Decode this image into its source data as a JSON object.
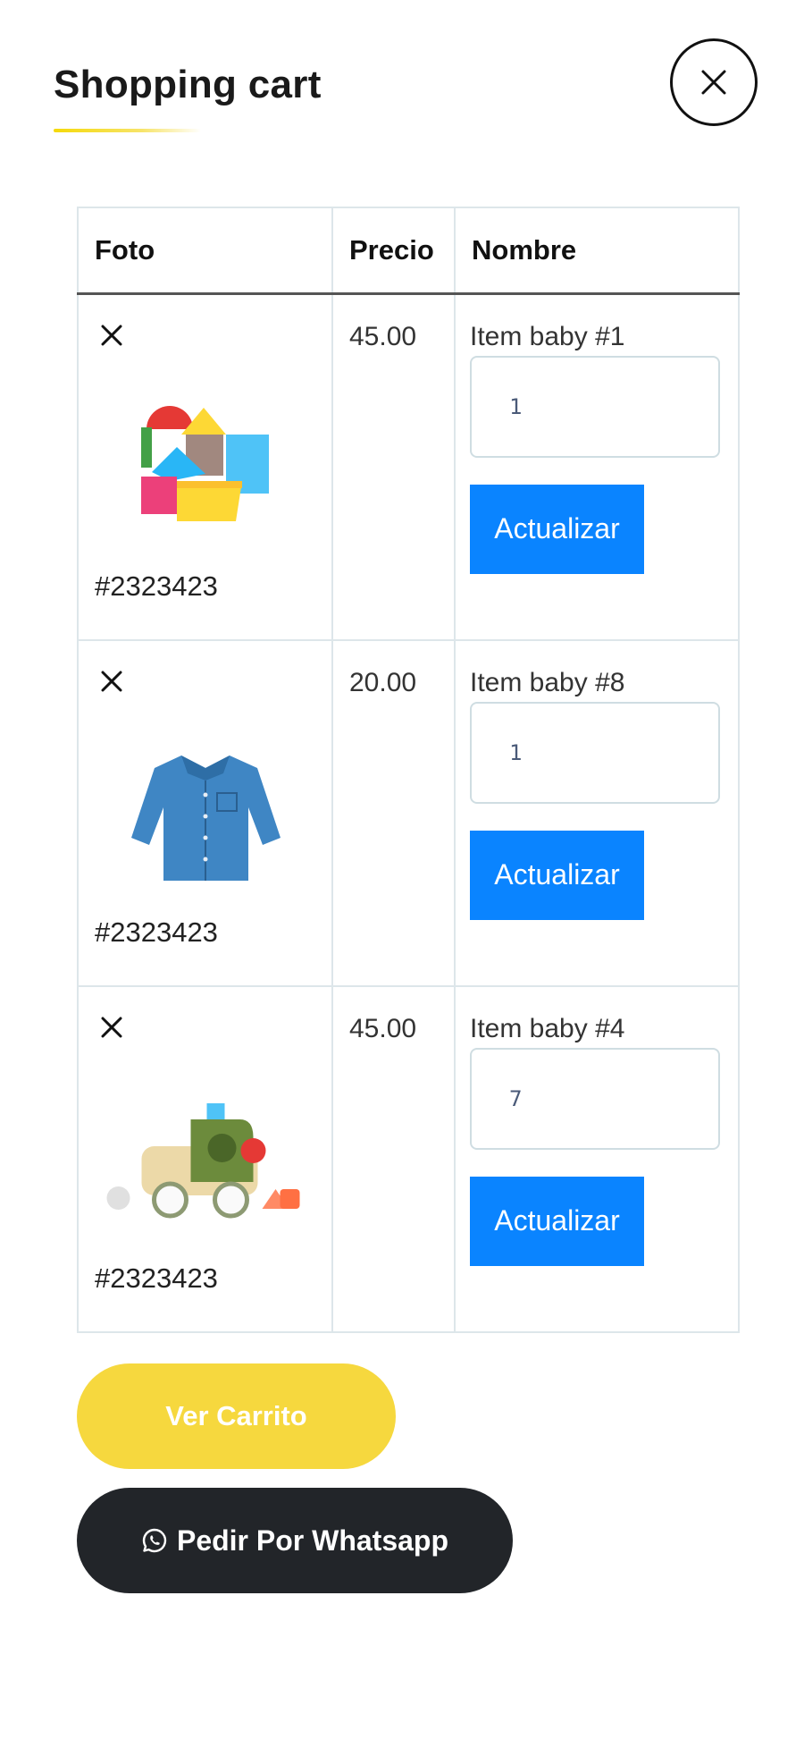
{
  "header": {
    "title": "Shopping cart",
    "close_icon": "close-icon",
    "accent_color": "#f5d90a"
  },
  "table": {
    "headers": [
      "Foto",
      "Precio",
      "Nombre"
    ],
    "rows": [
      {
        "remove_icon": "close-icon",
        "image": "wooden-blocks-toy",
        "sku": "#2323423",
        "price": "45.00",
        "name": "Item baby #1",
        "quantity": "1",
        "update_label": "Actualizar"
      },
      {
        "remove_icon": "close-icon",
        "image": "denim-baby-shirt",
        "sku": "#2323423",
        "price": "20.00",
        "name": "Item baby #8",
        "quantity": "1",
        "update_label": "Actualizar"
      },
      {
        "remove_icon": "close-icon",
        "image": "toy-truck-shape-sorter",
        "sku": "#2323423",
        "price": "45.00",
        "name": "Item baby #4",
        "quantity": "7",
        "update_label": "Actualizar"
      }
    ]
  },
  "actions": {
    "view_cart_label": "Ver Carrito",
    "whatsapp_label": "Pedir Por Whatsapp",
    "whatsapp_icon": "whatsapp-icon",
    "update_color": "#0a84ff",
    "view_cart_color": "#f6d83e",
    "whatsapp_color": "#222529"
  }
}
